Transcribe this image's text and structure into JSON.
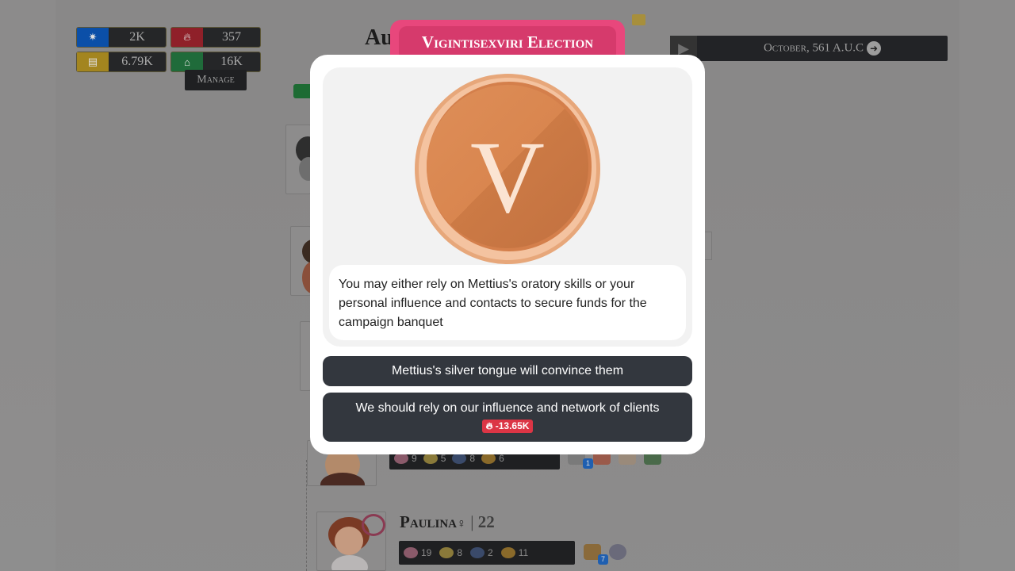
{
  "resources": {
    "influence": {
      "icon": "gear-icon",
      "value": "2K",
      "color": "#0d6efd"
    },
    "fire": {
      "icon": "fire-icon",
      "value": "357",
      "color": "#dc3545"
    },
    "coins": {
      "icon": "coins-icon",
      "value": "6.79K",
      "color": "#ffc107"
    },
    "house": {
      "icon": "house-icon",
      "value": "16K",
      "color": "#198754"
    },
    "manage_label": "Manage"
  },
  "background": {
    "heading_fragment": "Au",
    "date_label": "October, 561 A.U.C",
    "play_icon": "play-icon",
    "next_icon": "arrow-right-circle-icon"
  },
  "characters": {
    "row1_stats": [
      "9",
      "5",
      "8",
      "6"
    ],
    "row1_badge": "1",
    "paulina": {
      "name": "Paulina",
      "gender_icon": "female-icon",
      "separator": "|",
      "age": "22",
      "stats": [
        "19",
        "8",
        "2",
        "11"
      ],
      "badge": "7"
    }
  },
  "modal": {
    "title": "Vigintisexviri Election",
    "coin_letter": "V",
    "coin_icon": "bronze-coin-icon",
    "description": "You may either rely on Mettius's oratory skills or your personal influence and contacts to secure funds for the campaign banquet",
    "choices": [
      {
        "label": "Mettius's silver tongue will convince them"
      },
      {
        "label": "We should rely on our influence and network of clients",
        "cost": "-13.65K",
        "cost_icon": "fire-icon"
      }
    ],
    "colors": {
      "tab": "#e8477c",
      "badge": "#dc3545",
      "choice_bg": "#33373e"
    }
  }
}
